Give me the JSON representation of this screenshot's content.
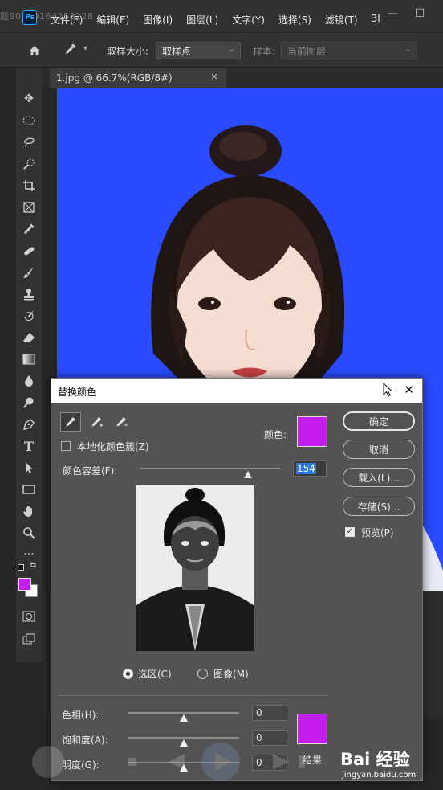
{
  "watermark_top": "题90150164258228",
  "app": {
    "logo": "Ps"
  },
  "menu": [
    "文件(F)",
    "编辑(E)",
    "图像(I)",
    "图层(L)",
    "文字(Y)",
    "选择(S)",
    "滤镜(T)",
    "3I"
  ],
  "window_controls": {
    "minimize": "—",
    "maximize": "☐"
  },
  "options_bar": {
    "sample_size_label": "取样大小:",
    "sample_size_value": "取样点",
    "sample_label": "样本:",
    "sample_value": "当前图层"
  },
  "document": {
    "tab_title": "1.jpg @ 66.7%(RGB/8#)",
    "close": "×"
  },
  "toolbar": {
    "tools": [
      "move-icon",
      "marquee-icon",
      "lasso-icon",
      "quick-select-icon",
      "crop-icon",
      "frame-icon",
      "eyedropper-icon",
      "healing-icon",
      "brush-icon",
      "stamp-icon",
      "history-brush-icon",
      "eraser-icon",
      "gradient-icon",
      "blur-icon",
      "dodge-icon",
      "pen-icon",
      "type-icon",
      "path-select-icon",
      "rectangle-icon",
      "hand-icon",
      "zoom-icon",
      "more-icon"
    ],
    "foreground_color": "#c41ff0",
    "background_color": "#ffffff"
  },
  "dialog": {
    "title": "替换颜色",
    "close": "✕",
    "color_label": "颜色:",
    "color_value": "#c41ff0",
    "localized_clusters_label": "本地化颜色簇(Z)",
    "localized_clusters_checked": false,
    "fuzziness_label": "颜色容差(F):",
    "fuzziness_value": "154",
    "fuzziness_max": 200,
    "selection_label": "选区(C)",
    "image_label": "图像(M)",
    "selection_mode": "selection",
    "hue_label": "色相(H):",
    "hue_value": "0",
    "saturation_label": "饱和度(A):",
    "saturation_value": "0",
    "lightness_label": "明度(G):",
    "lightness_value": "0",
    "result_label": "结果",
    "result_color": "#c41ff0",
    "buttons": {
      "ok": "确定",
      "cancel": "取消",
      "load": "载入(L)...",
      "save": "存储(S)..."
    },
    "preview_label": "预览(P)",
    "preview_checked": true
  },
  "baidu": {
    "logo": "Bai 经验",
    "url": "jingyan.baidu.com"
  }
}
